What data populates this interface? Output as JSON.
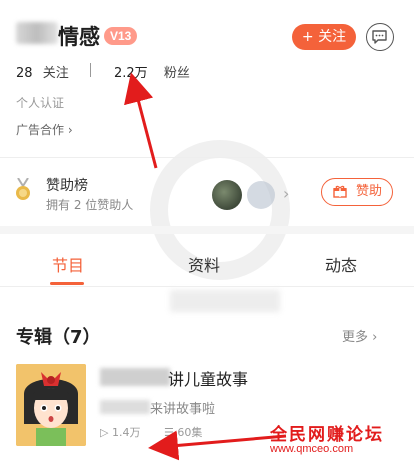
{
  "profile": {
    "name_visible": "情感",
    "level_badge": "V13",
    "follow_label": "+ 关注",
    "following_count": "28",
    "following_label": "关注",
    "followers_count": "2.2万",
    "followers_label": "粉丝",
    "certification": "个人认证",
    "ad_cooperation": "广告合作 ›"
  },
  "sponsor": {
    "title": "赞助榜",
    "subtitle": "拥有 2 位赞助人",
    "button_label": "赞助"
  },
  "tabs": [
    {
      "label": "节目"
    },
    {
      "label": "资料"
    },
    {
      "label": "动态"
    }
  ],
  "album": {
    "heading": "专辑（7）",
    "more_label": "更多 ›",
    "title_visible": "讲儿童故事",
    "desc_visible": "来讲故事啦",
    "plays": "1.4万",
    "episodes": "60集"
  },
  "watermark": {
    "forum_name": "全民网赚论坛",
    "forum_url": "www.qmceo.com"
  },
  "colors": {
    "accent": "#f4623a",
    "annotation_red": "#e21c1c"
  }
}
